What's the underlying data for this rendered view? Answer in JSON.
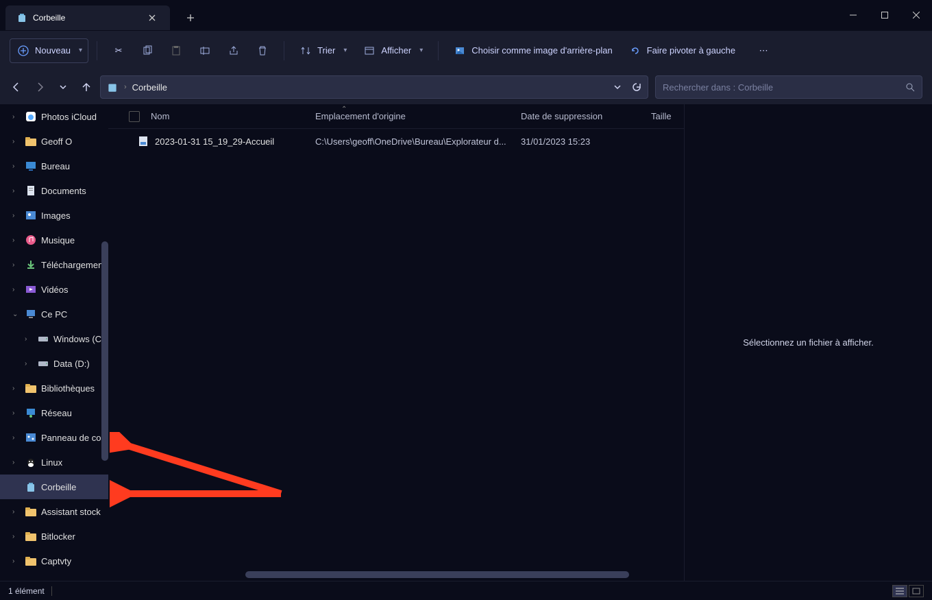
{
  "tab": {
    "title": "Corbeille"
  },
  "toolbar": {
    "new": "Nouveau",
    "sort": "Trier",
    "view": "Afficher",
    "set_bg": "Choisir comme image d'arrière-plan",
    "rotate": "Faire pivoter à gauche"
  },
  "address": {
    "path": "Corbeille"
  },
  "search": {
    "placeholder": "Rechercher dans : Corbeille"
  },
  "sidebar": {
    "items": [
      {
        "label": "Photos iCloud",
        "icon": "icloud",
        "chev": ">"
      },
      {
        "label": "Geoff O",
        "icon": "folder",
        "chev": ">"
      },
      {
        "label": "Bureau",
        "icon": "desktop",
        "chev": ">"
      },
      {
        "label": "Documents",
        "icon": "doc",
        "chev": ">"
      },
      {
        "label": "Images",
        "icon": "images",
        "chev": ">"
      },
      {
        "label": "Musique",
        "icon": "music",
        "chev": ">"
      },
      {
        "label": "Téléchargemen",
        "icon": "download",
        "chev": ">"
      },
      {
        "label": "Vidéos",
        "icon": "video",
        "chev": ">"
      },
      {
        "label": "Ce PC",
        "icon": "pc",
        "chev": "v"
      },
      {
        "label": "Windows (C:)",
        "icon": "drive",
        "chev": ">",
        "sub": true
      },
      {
        "label": "Data (D:)",
        "icon": "drive",
        "chev": ">",
        "sub": true
      },
      {
        "label": "Bibliothèques",
        "icon": "folder",
        "chev": ">"
      },
      {
        "label": "Réseau",
        "icon": "network",
        "chev": ">"
      },
      {
        "label": "Panneau de co",
        "icon": "panel",
        "chev": ">"
      },
      {
        "label": "Linux",
        "icon": "linux",
        "chev": ">"
      },
      {
        "label": "Corbeille",
        "icon": "bin",
        "chev": "",
        "selected": true
      },
      {
        "label": "Assistant stock",
        "icon": "folder",
        "chev": ">"
      },
      {
        "label": "Bitlocker",
        "icon": "folder",
        "chev": ">"
      },
      {
        "label": "Captvty",
        "icon": "folder",
        "chev": ">"
      }
    ]
  },
  "columns": {
    "name": "Nom",
    "origin": "Emplacement d'origine",
    "date": "Date de suppression",
    "size": "Taille"
  },
  "rows": [
    {
      "name": "2023-01-31 15_19_29-Accueil",
      "origin": "C:\\Users\\geoff\\OneDrive\\Bureau\\Explorateur d...",
      "date": "31/01/2023 15:23"
    }
  ],
  "preview": {
    "empty": "Sélectionnez un fichier à afficher."
  },
  "status": {
    "count": "1 élément"
  }
}
